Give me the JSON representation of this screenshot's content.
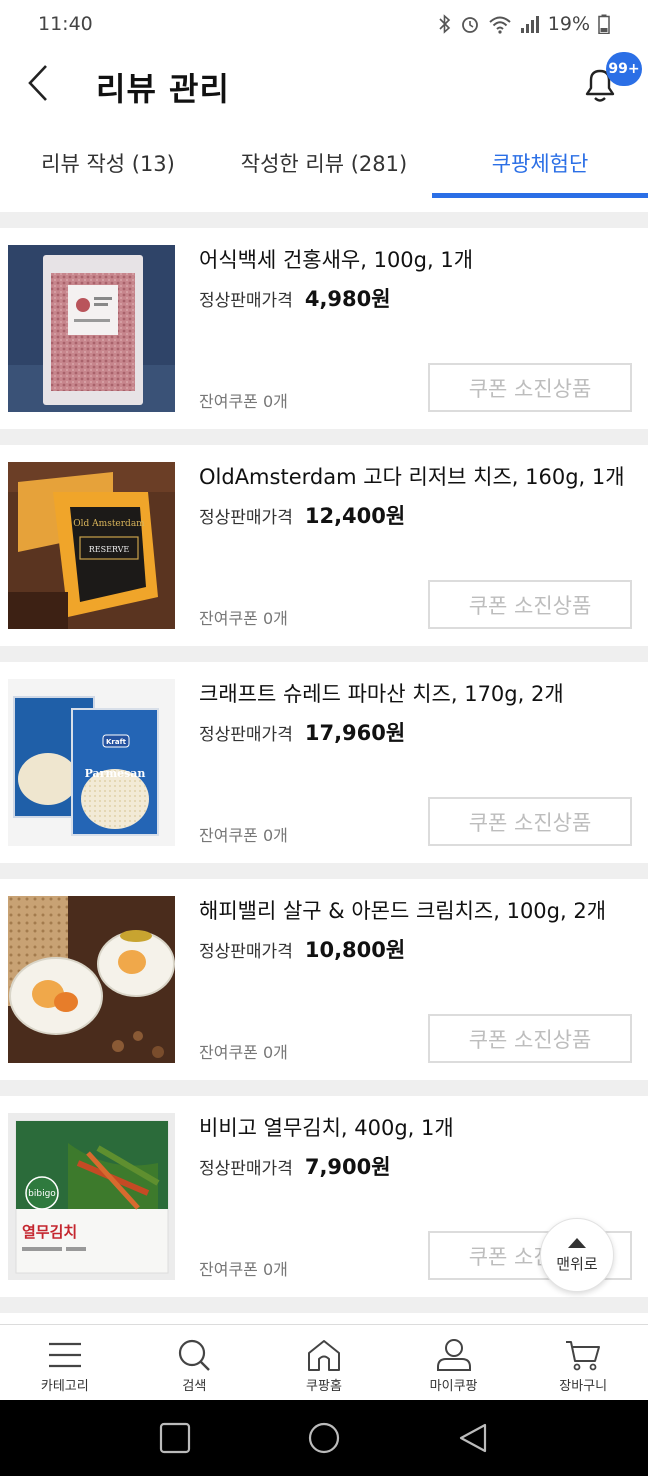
{
  "status_bar": {
    "time": "11:40",
    "battery": "19%"
  },
  "header": {
    "title": "리뷰 관리",
    "badge": "99+"
  },
  "tabs": [
    {
      "label": "리뷰 작성 (13)",
      "active": false
    },
    {
      "label": "작성한 리뷰 (281)",
      "active": false
    },
    {
      "label": "쿠팡체험단",
      "active": true
    }
  ],
  "items": [
    {
      "name": "어식백세 건홍새우, 100g, 1개",
      "price_label": "정상판매가격",
      "price": "4,980원",
      "remaining": "잔여쿠폰 0개",
      "button": "쿠폰 소진상품"
    },
    {
      "name": "OldAmsterdam 고다 리저브 치즈, 160g, 1개",
      "price_label": "정상판매가격",
      "price": "12,400원",
      "remaining": "잔여쿠폰 0개",
      "button": "쿠폰 소진상품"
    },
    {
      "name": "크래프트 슈레드 파마산 치즈, 170g, 2개",
      "price_label": "정상판매가격",
      "price": "17,960원",
      "remaining": "잔여쿠폰 0개",
      "button": "쿠폰 소진상품"
    },
    {
      "name": "해피밸리 살구 & 아몬드 크림치즈, 100g, 2개",
      "price_label": "정상판매가격",
      "price": "10,800원",
      "remaining": "잔여쿠폰 0개",
      "button": "쿠폰 소진상품"
    },
    {
      "name": "비비고 열무김치, 400g, 1개",
      "price_label": "정상판매가격",
      "price": "7,900원",
      "remaining": "잔여쿠폰 0개",
      "button": "쿠폰 소진상품"
    }
  ],
  "thumb_text": {
    "cheese_brand": "Old Amsterdam",
    "cheese_label": "RESERVE",
    "kraft_brand": "Kraft",
    "kraft_product": "Parmesan",
    "bibigo_brand": "bibigo",
    "bibigo_product": "열무김치"
  },
  "scroll_top": {
    "label": "맨위로"
  },
  "bottom_nav": [
    {
      "label": "카테고리",
      "icon": "menu-icon"
    },
    {
      "label": "검색",
      "icon": "search-icon"
    },
    {
      "label": "쿠팡홈",
      "icon": "home-icon"
    },
    {
      "label": "마이쿠팡",
      "icon": "person-icon"
    },
    {
      "label": "장바구니",
      "icon": "cart-icon"
    }
  ],
  "colors": {
    "accent": "#2b6fe6",
    "disabled_text": "#bdbdbd",
    "divider": "#efefef"
  }
}
